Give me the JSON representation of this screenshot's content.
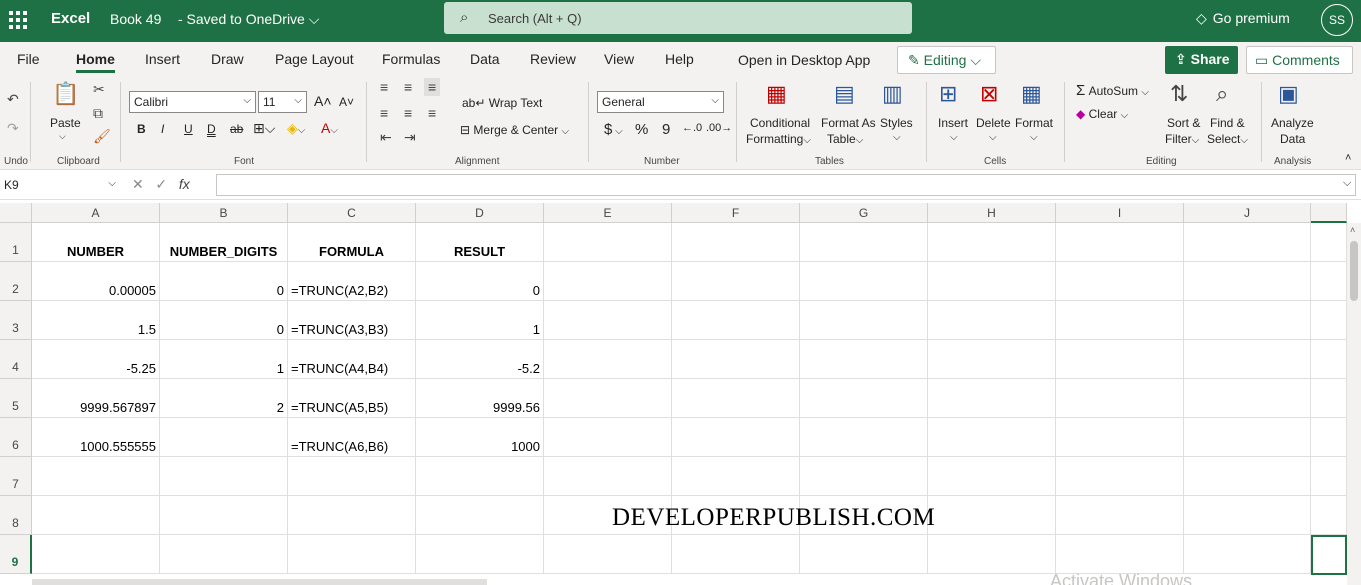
{
  "titlebar": {
    "app_name": "Excel",
    "doc_name": "Book 49",
    "doc_status": "-  Saved to OneDrive ⌵",
    "search_placeholder": "Search (Alt + Q)",
    "premium": "Go premium",
    "avatar": "SS",
    "brand_color": "#1e7145"
  },
  "menu": {
    "tabs": [
      "File",
      "Home",
      "Insert",
      "Draw",
      "Page Layout",
      "Formulas",
      "Data",
      "Review",
      "View",
      "Help"
    ],
    "active_tab": "Home",
    "open_desktop": "Open in Desktop App",
    "editing": "Editing",
    "share": "Share",
    "comments": "Comments"
  },
  "ribbon": {
    "undo_label": "Undo",
    "paste": "Paste",
    "clipboard": "Clipboard",
    "font_name": "Calibri",
    "font_size": "11",
    "font_group": "Font",
    "wrap_text": "Wrap Text",
    "merge_center": "Merge & Center",
    "alignment": "Alignment",
    "number_format": "General",
    "number_group": "Number",
    "conditional_1": "Conditional",
    "conditional_2": "Formatting",
    "format_table_1": "Format As",
    "format_table_2": "Table",
    "styles": "Styles",
    "tables_group": "Tables",
    "insert": "Insert",
    "delete": "Delete",
    "format": "Format",
    "cells_group": "Cells",
    "autosum": "AutoSum",
    "clear": "Clear",
    "sort_1": "Sort &",
    "sort_2": "Filter",
    "find_1": "Find &",
    "find_2": "Select",
    "editing_group": "Editing",
    "analyze_1": "Analyze",
    "analyze_2": "Data",
    "analysis_group": "Analysis"
  },
  "formula_bar": {
    "name_box": "K9",
    "fx": "fx"
  },
  "sheet": {
    "columns": [
      "A",
      "B",
      "C",
      "D",
      "E",
      "F",
      "G",
      "H",
      "I",
      "J"
    ],
    "rows": [
      "1",
      "2",
      "3",
      "4",
      "5",
      "6",
      "7",
      "8",
      "9"
    ],
    "header": [
      "NUMBER",
      "NUMBER_DIGITS",
      "FORMULA",
      "RESULT"
    ],
    "data": [
      [
        "0.00005",
        "0",
        "=TRUNC(A2,B2)",
        "0"
      ],
      [
        "1.5",
        "0",
        "=TRUNC(A3,B3)",
        "1"
      ],
      [
        "-5.25",
        "1",
        "=TRUNC(A4,B4)",
        "-5.2"
      ],
      [
        "9999.567897",
        "2",
        "=TRUNC(A5,B5)",
        "9999.56"
      ],
      [
        "1000.555555",
        "",
        "=TRUNC(A6,B6)",
        "1000"
      ]
    ],
    "watermark": "DEVELOPERPUBLISH.COM",
    "activate_windows": "Activate Windows"
  }
}
